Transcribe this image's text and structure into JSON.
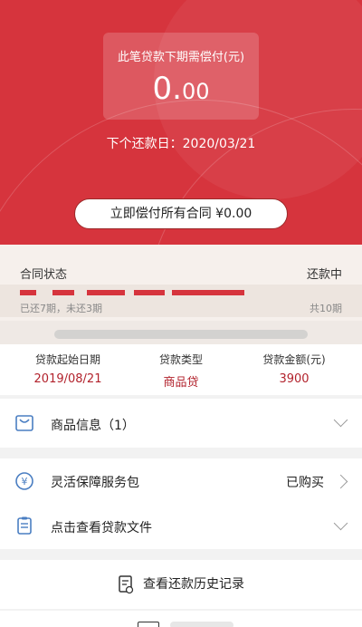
{
  "hero": {
    "due_title": "此笔贷款下期需偿付(元)",
    "due_amount_integer": "0.",
    "due_amount_decimal": "00",
    "next_due_label": "下个还款日：2020/03/21",
    "pay_all_button": "立即偿付所有合同 ¥0.00",
    "bg_color": "#d6343d"
  },
  "status": {
    "label": "合同状态",
    "value": "还款中",
    "paid_periods": "已还7期，未还3期",
    "total_periods": "共10期"
  },
  "loan": {
    "start_label": "贷款起始日期",
    "start_value": "2019/08/21",
    "type_label": "贷款类型",
    "type_value": "商品贷",
    "amount_label": "贷款金额(元)",
    "amount_value": "3900"
  },
  "rows": {
    "goods_info": "商品信息（1）",
    "service_pack": "灵活保障服务包",
    "service_status": "已购买",
    "loan_docs": "点击查看贷款文件",
    "history": "查看还款历史记录"
  },
  "icons": {
    "goods": "shopping-bag-icon",
    "service": "shield-yen-icon",
    "docs": "clipboard-icon",
    "history": "receipt-icon"
  }
}
